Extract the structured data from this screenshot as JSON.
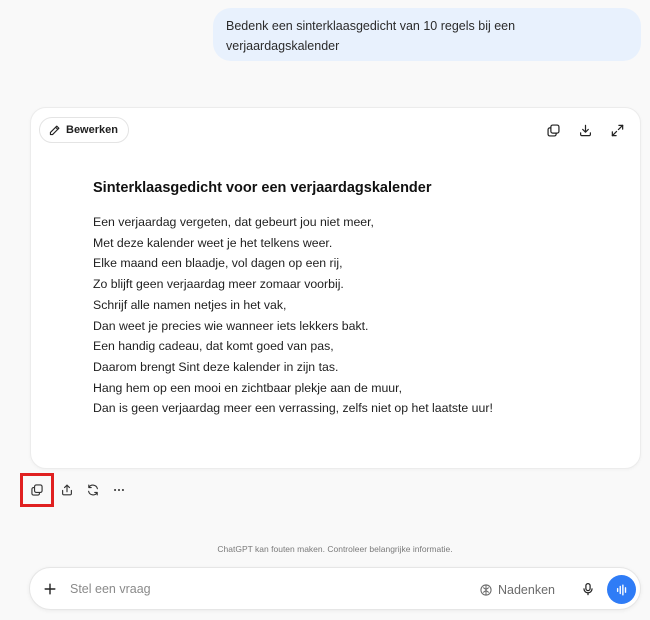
{
  "user_message": "Bedenk een sinterklaasgedicht van 10 regels bij een verjaardagskalender",
  "canvas": {
    "edit_label": "Bewerken",
    "title": "Sinterklaasgedicht voor een verjaardagskalender",
    "lines": [
      "Een verjaardag vergeten, dat gebeurt jou niet meer,",
      "Met deze kalender weet je het telkens weer.",
      "Elke maand een blaadje, vol dagen op een rij,",
      "Zo blijft geen verjaardag meer zomaar voorbij.",
      "Schrijf alle namen netjes in het vak,",
      "Dan weet je precies wie wanneer iets lekkers bakt.",
      "Een handig cadeau, dat komt goed van pas,",
      "Daarom brengt Sint deze kalender in zijn tas.",
      "Hang hem op een mooi en zichtbaar plekje aan de muur,",
      "Dan is geen verjaardag meer een verrassing, zelfs niet op het laatste uur!"
    ],
    "icons": [
      "copy-icon",
      "download-icon",
      "expand-icon"
    ]
  },
  "message_actions": [
    "copy-icon",
    "share-icon",
    "regenerate-icon",
    "more-icon"
  ],
  "disclaimer": "ChatGPT kan fouten maken. Controleer belangrijke informatie.",
  "composer": {
    "placeholder": "Stel een vraag",
    "think_label": "Nadenken"
  },
  "colors": {
    "user_bubble": "#e8f1fd",
    "voice_button": "#2f7cf6",
    "highlight_box": "#e02020"
  }
}
